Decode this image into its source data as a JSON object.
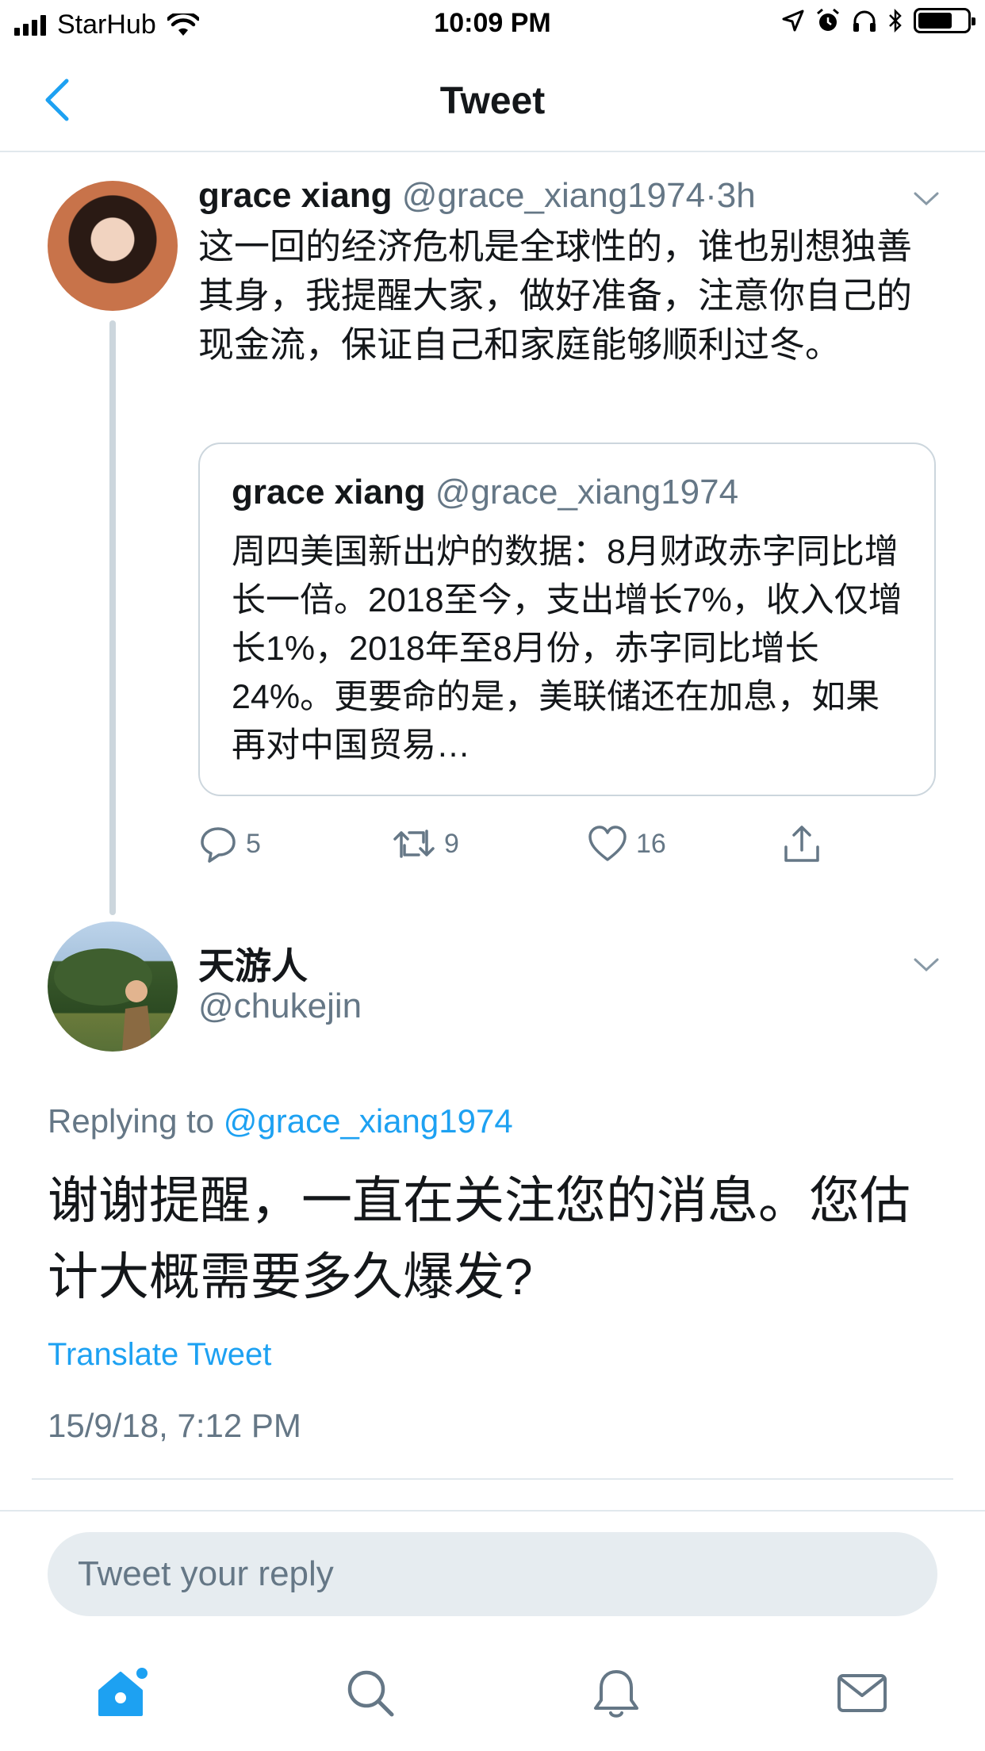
{
  "status_bar": {
    "carrier": "StarHub",
    "time": "10:09 PM"
  },
  "nav": {
    "title": "Tweet"
  },
  "tweet": {
    "name": "grace xiang",
    "handle": "@grace_xiang1974",
    "separator": "·",
    "time_ago": "3h",
    "text": "这一回的经济危机是全球性的，谁也别想独善其身，我提醒大家，做好准备，注意你自己的现金流，保证自己和家庭能够顺利过冬。",
    "quote": {
      "name": "grace xiang",
      "handle": "@grace_xiang1974",
      "text": "周四美国新出炉的数据：8月财政赤字同比增长一倍。2018至今，支出增长7%，收入仅增长1%，2018年至8月份，赤字同比增长24%。更要命的是，美联储还在加息，如果再对中国贸易…"
    },
    "replies": "5",
    "retweets": "9",
    "likes": "16"
  },
  "reply_tweet": {
    "name": "天游人",
    "handle": "@chukejin",
    "replying_label": "Replying to",
    "replying_to": "@grace_xiang1974",
    "text": "谢谢提醒，一直在关注您的消息。您估计大概需要多久爆发?",
    "translate_label": "Translate Tweet",
    "timestamp": "15/9/18, 7:12 PM"
  },
  "composer": {
    "placeholder": "Tweet your reply"
  },
  "colors": {
    "accent": "#1da1f2",
    "secondary_text": "#657786",
    "border": "#e1e8ed"
  },
  "icons": [
    "back-chevron-icon",
    "caret-down-icon",
    "reply-icon",
    "retweet-icon",
    "like-icon",
    "share-icon",
    "home-icon",
    "search-icon",
    "notifications-icon",
    "messages-icon"
  ]
}
